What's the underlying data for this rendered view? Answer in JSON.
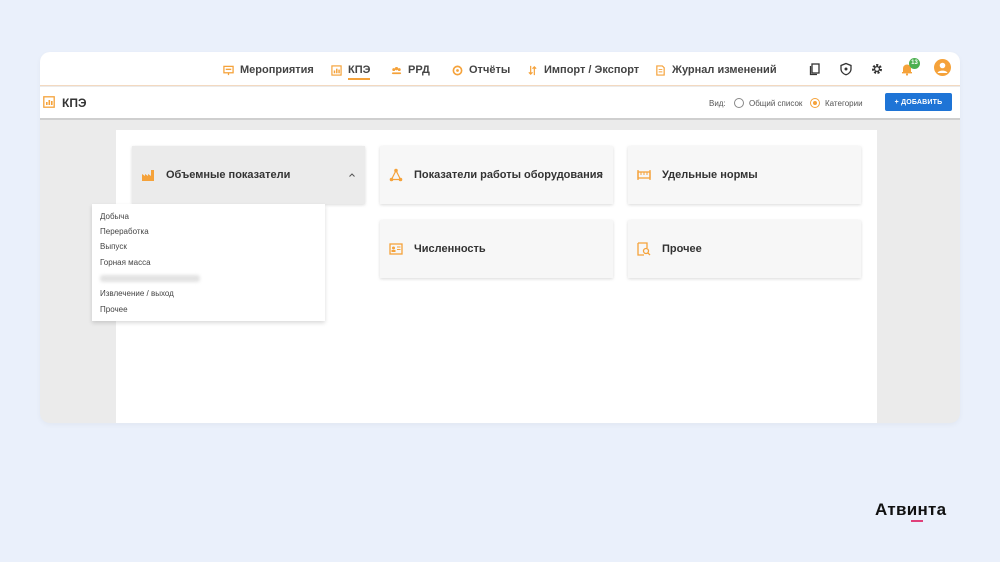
{
  "nav": {
    "items": [
      {
        "label": "Мероприятия",
        "icon": "presentation-icon"
      },
      {
        "label": "КПЭ",
        "icon": "chart-icon",
        "active": true
      },
      {
        "label": "РРД",
        "icon": "people-icon"
      },
      {
        "label": "Отчёты",
        "icon": "report-icon"
      },
      {
        "label": "Импорт / Экспорт",
        "icon": "import-export-icon"
      },
      {
        "label": "Журнал изменений",
        "icon": "document-icon"
      }
    ],
    "notification_count": "13"
  },
  "subbar": {
    "title": "КПЭ",
    "view_label": "Вид:",
    "view_options": [
      "Общий список",
      "Категории"
    ],
    "selected_view": "Категории",
    "add_button": "+ ДОБАВИТЬ"
  },
  "cards": {
    "volume": "Объемные показатели",
    "equipment": "Показатели работы оборудования",
    "norms": "Удельные нормы",
    "headcount": "Численность",
    "other": "Прочее"
  },
  "dropdown": {
    "items": [
      "Добыча",
      "Переработка",
      "Выпуск",
      "Горная масса",
      "Извлечение / выход",
      "Прочее"
    ]
  },
  "brand": "Атвинта",
  "colors": {
    "accent": "#f5a23a",
    "primary": "#1e74d6",
    "badge": "#4caf50"
  }
}
